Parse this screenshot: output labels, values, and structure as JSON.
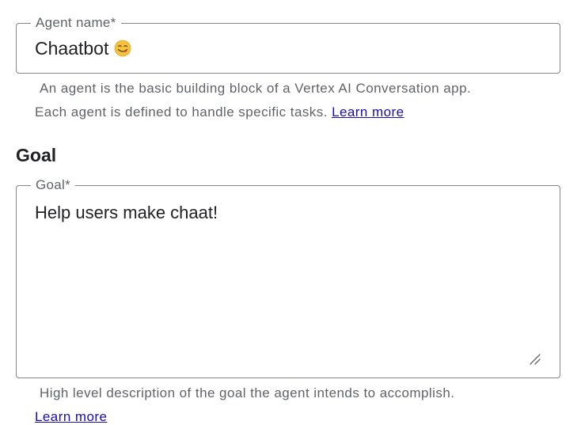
{
  "agent_name": {
    "label": "Agent name*",
    "value": "Chaatbot",
    "emoji_icon": "face-savoring-food-emoji",
    "hint_line1": "An agent is the basic building block of a Vertex AI Conversation app.",
    "hint_line2": "Each agent is defined to handle specific tasks.",
    "learn_more": "Learn more"
  },
  "goal_section": {
    "title": "Goal",
    "label": "Goal*",
    "value": "Help users make chaat!",
    "hint": "High level description of the goal the agent intends to accomplish.",
    "learn_more": "Learn more"
  },
  "colors": {
    "border": "#80868b",
    "label": "#5f6368",
    "text": "#202124",
    "link": "#1a0dab"
  }
}
